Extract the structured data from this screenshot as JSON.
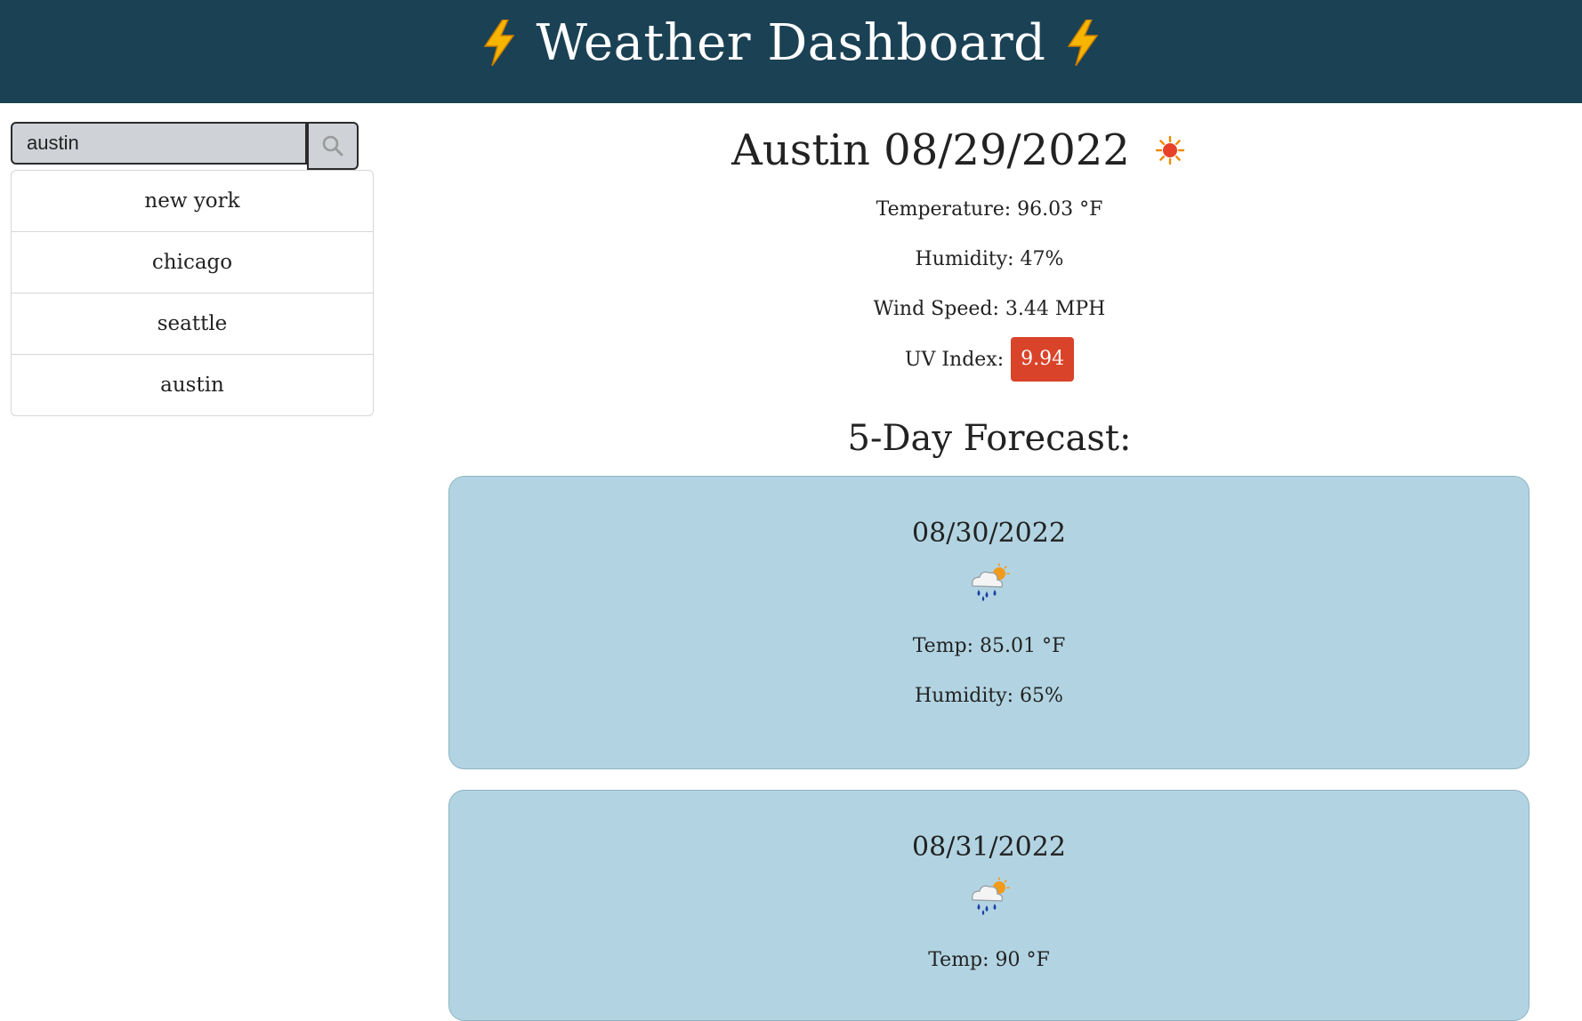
{
  "header": {
    "title": "Weather Dashboard",
    "left_icon": "lightning-bolt-icon",
    "right_icon": "lightning-bolt-icon"
  },
  "search": {
    "value": "austin",
    "button_icon": "search-icon"
  },
  "history": [
    "new york",
    "chicago",
    "seattle",
    "austin"
  ],
  "current": {
    "title": "Austin 08/29/2022",
    "icon": "sun-icon",
    "temperature": "Temperature: 96.03 °F",
    "humidity": "Humidity: 47%",
    "wind": "Wind Speed: 3.44 MPH",
    "uv_label": "UV Index:",
    "uv_value": "9.94",
    "uv_color": "#d9432a"
  },
  "forecast": {
    "title": "5-Day Forecast:",
    "days": [
      {
        "date": "08/30/2022",
        "icon": "rain-sun-icon",
        "temp": "Temp: 85.01 °F",
        "humidity": "Humidity: 65%"
      },
      {
        "date": "08/31/2022",
        "icon": "rain-sun-icon",
        "temp": "Temp: 90 °F"
      }
    ]
  },
  "colors": {
    "header_bg": "#1b4154",
    "card_bg": "#b2d4e2",
    "input_bg": "#cfd3d7"
  }
}
